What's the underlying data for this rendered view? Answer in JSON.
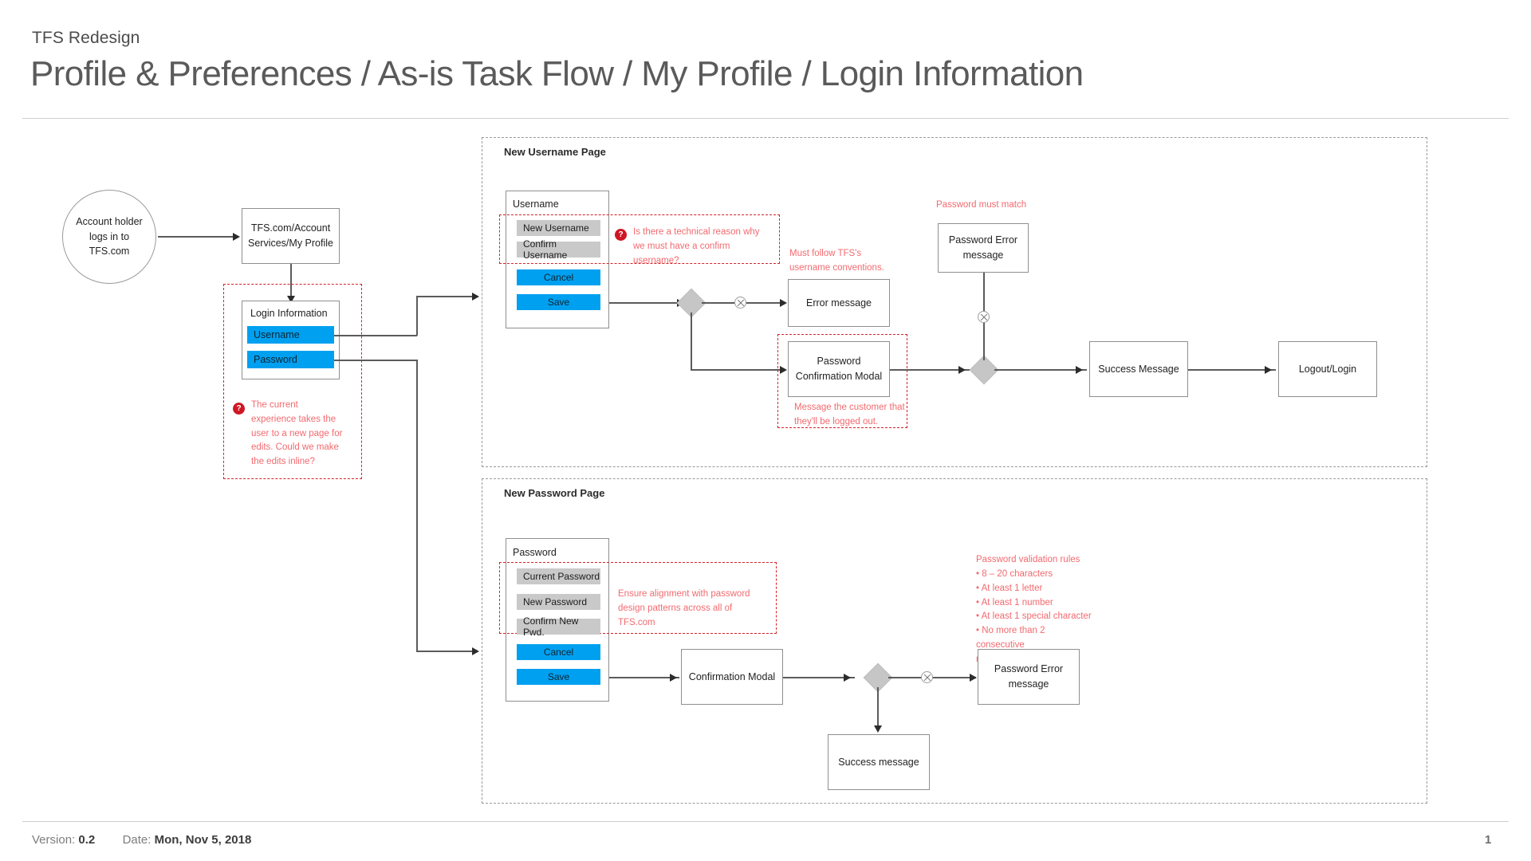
{
  "header": {
    "project": "TFS Redesign",
    "title": "Profile & Preferences / As-is Task Flow / My Profile / Login Information"
  },
  "footer": {
    "version_label": "Version:",
    "version_value": "0.2",
    "date_label": "Date:",
    "date_value": "Mon, Nov 5, 2018",
    "page_number": "1"
  },
  "colors": {
    "accent_blue": "#00a0f0",
    "field_gray": "#c9c9c9",
    "annotation_red": "#f36a6f",
    "annotation_border": "#d42229",
    "badge_red": "#cf1724",
    "gateway_gray": "#c6c6c6"
  },
  "entry": {
    "start_node": "Account holder logs in to TFS.com",
    "page_node": "TFS.com/Account Services/My Profile"
  },
  "login_panel": {
    "title": "Login Information",
    "fields": [
      {
        "label": "Username"
      },
      {
        "label": "Password"
      }
    ],
    "note": "The current experience takes the user to a new page for edits. Could we make the edits inline?",
    "badge": "?"
  },
  "username_lane": {
    "title": "New Username Page",
    "panel": {
      "title": "Username",
      "fields": [
        {
          "label": "New Username"
        },
        {
          "label": "Confirm Username"
        }
      ],
      "buttons": [
        {
          "label": "Cancel"
        },
        {
          "label": "Save"
        }
      ]
    },
    "notes": {
      "confirm_username": "Is there a technical reason why we must have a confirm username?",
      "confirm_username_badge": "?",
      "username_conventions": "Must follow TFS's username conventions.",
      "logged_out": "Message the customer that they'll be logged out.",
      "password_must_match": "Password must match"
    },
    "nodes": {
      "error_message": "Error message",
      "password_confirmation_modal": "Password Confirmation Modal",
      "password_error_message": "Password Error message",
      "success_message": "Success Message",
      "logout_login": "Logout/Login"
    }
  },
  "password_lane": {
    "title": "New Password Page",
    "panel": {
      "title": "Password",
      "fields": [
        {
          "label": "Current Password"
        },
        {
          "label": "New Password"
        },
        {
          "label": "Confirm New Pwd."
        }
      ],
      "buttons": [
        {
          "label": "Cancel"
        },
        {
          "label": "Save"
        }
      ]
    },
    "notes": {
      "alignment": "Ensure alignment with password design patterns across all of TFS.com",
      "validation_title": "Password validation rules",
      "validation_rules": [
        "• 8 – 20 characters",
        "• At least 1 letter",
        "• At least 1 number",
        "• At least 1 special character",
        "• No more than 2 consecutive",
        "repeating characters"
      ]
    },
    "nodes": {
      "confirmation_modal": "Confirmation Modal",
      "password_error_message": "Password Error message",
      "success_message": "Success message"
    }
  }
}
